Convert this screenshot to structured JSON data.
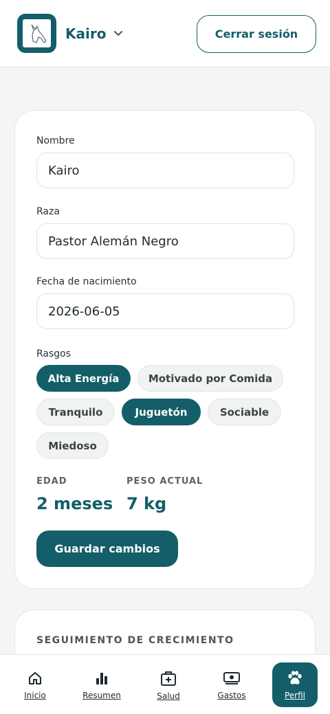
{
  "header": {
    "pet_name": "Kairo",
    "logout_label": "Cerrar sesión"
  },
  "form": {
    "name_label": "Nombre",
    "name_value": "Kairo",
    "breed_label": "Raza",
    "breed_value": "Pastor Alemán Negro",
    "birth_label": "Fecha de nacimiento",
    "birth_value": "2026-06-05",
    "traits_label": "Rasgos",
    "traits": [
      {
        "label": "Alta Energía",
        "selected": true
      },
      {
        "label": "Motivado por Comida",
        "selected": false
      },
      {
        "label": "Tranquilo",
        "selected": false
      },
      {
        "label": "Juguetón",
        "selected": true
      },
      {
        "label": "Sociable",
        "selected": false
      },
      {
        "label": "Miedoso",
        "selected": false
      }
    ],
    "age_label": "EDAD",
    "age_value": "2 meses",
    "weight_label": "PESO ACTUAL",
    "weight_value": "7 kg",
    "save_label": "Guardar cambios"
  },
  "growth": {
    "title": "SEGUIMIENTO DE CRECIMIENTO"
  },
  "nav": {
    "items": [
      {
        "label": "Inicio",
        "icon": "home-icon",
        "active": false
      },
      {
        "label": "Resumen",
        "icon": "bar-chart-icon",
        "active": false
      },
      {
        "label": "Salud",
        "icon": "medical-kit-icon",
        "active": false
      },
      {
        "label": "Gastos",
        "icon": "money-icon",
        "active": false
      },
      {
        "label": "Perfil",
        "icon": "paw-icon",
        "active": true
      }
    ]
  },
  "colors": {
    "primary": "#135e69",
    "background": "#f4f5f5",
    "chip_off": "#f1f2f2"
  }
}
